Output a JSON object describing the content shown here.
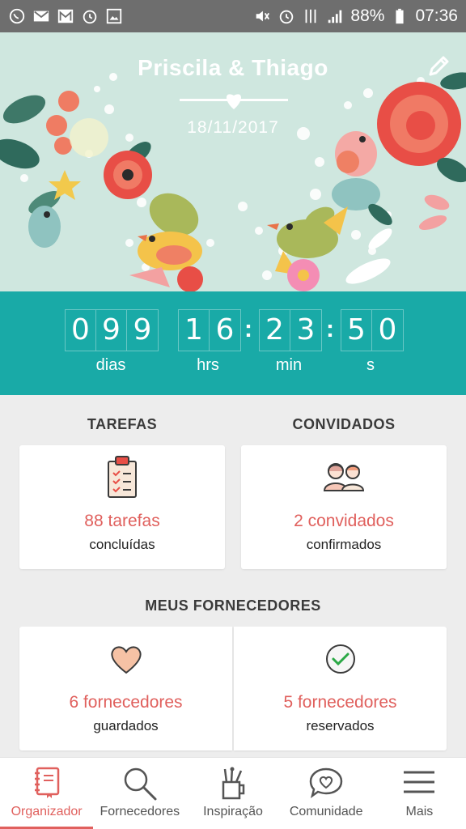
{
  "status_bar": {
    "battery": "88%",
    "time": "07:36",
    "left_icons": [
      "whatsapp-icon",
      "gmail-icon",
      "gmail-icon",
      "alarm-icon",
      "image-icon"
    ],
    "right_icons": [
      "mute-icon",
      "alarm-icon",
      "vibrate-icon",
      "signal-icon",
      "battery-icon"
    ]
  },
  "hero": {
    "couple": "Priscila & Thiago",
    "date": "18/11/2017"
  },
  "countdown": {
    "days": [
      "0",
      "9",
      "9"
    ],
    "hours": [
      "1",
      "6"
    ],
    "minutes": [
      "2",
      "3"
    ],
    "seconds": [
      "5",
      "0"
    ],
    "labels": {
      "days": "dias",
      "hours": "hrs",
      "minutes": "min",
      "seconds": "s"
    }
  },
  "tasks": {
    "title": "TAREFAS",
    "count": "88 tarefas",
    "sub": "concluídas"
  },
  "guests": {
    "title": "CONVIDADOS",
    "count": "2 convidados",
    "sub": "confirmados"
  },
  "vendors": {
    "title": "MEUS FORNECEDORES",
    "saved_count": "6 fornecedores",
    "saved_sub": "guardados",
    "booked_count": "5 fornecedores",
    "booked_sub": "reservados"
  },
  "nav": {
    "items": [
      {
        "label": "Organizador",
        "icon": "notebook-icon",
        "active": true
      },
      {
        "label": "Fornecedores",
        "icon": "search-icon",
        "active": false
      },
      {
        "label": "Inspiração",
        "icon": "brushes-cup-icon",
        "active": false
      },
      {
        "label": "Comunidade",
        "icon": "heart-chat-icon",
        "active": false
      },
      {
        "label": "Mais",
        "icon": "menu-icon",
        "active": false
      }
    ]
  },
  "colors": {
    "accent": "#e0605d",
    "teal": "#19aaa7",
    "hero_bg": "#cfe7df"
  }
}
